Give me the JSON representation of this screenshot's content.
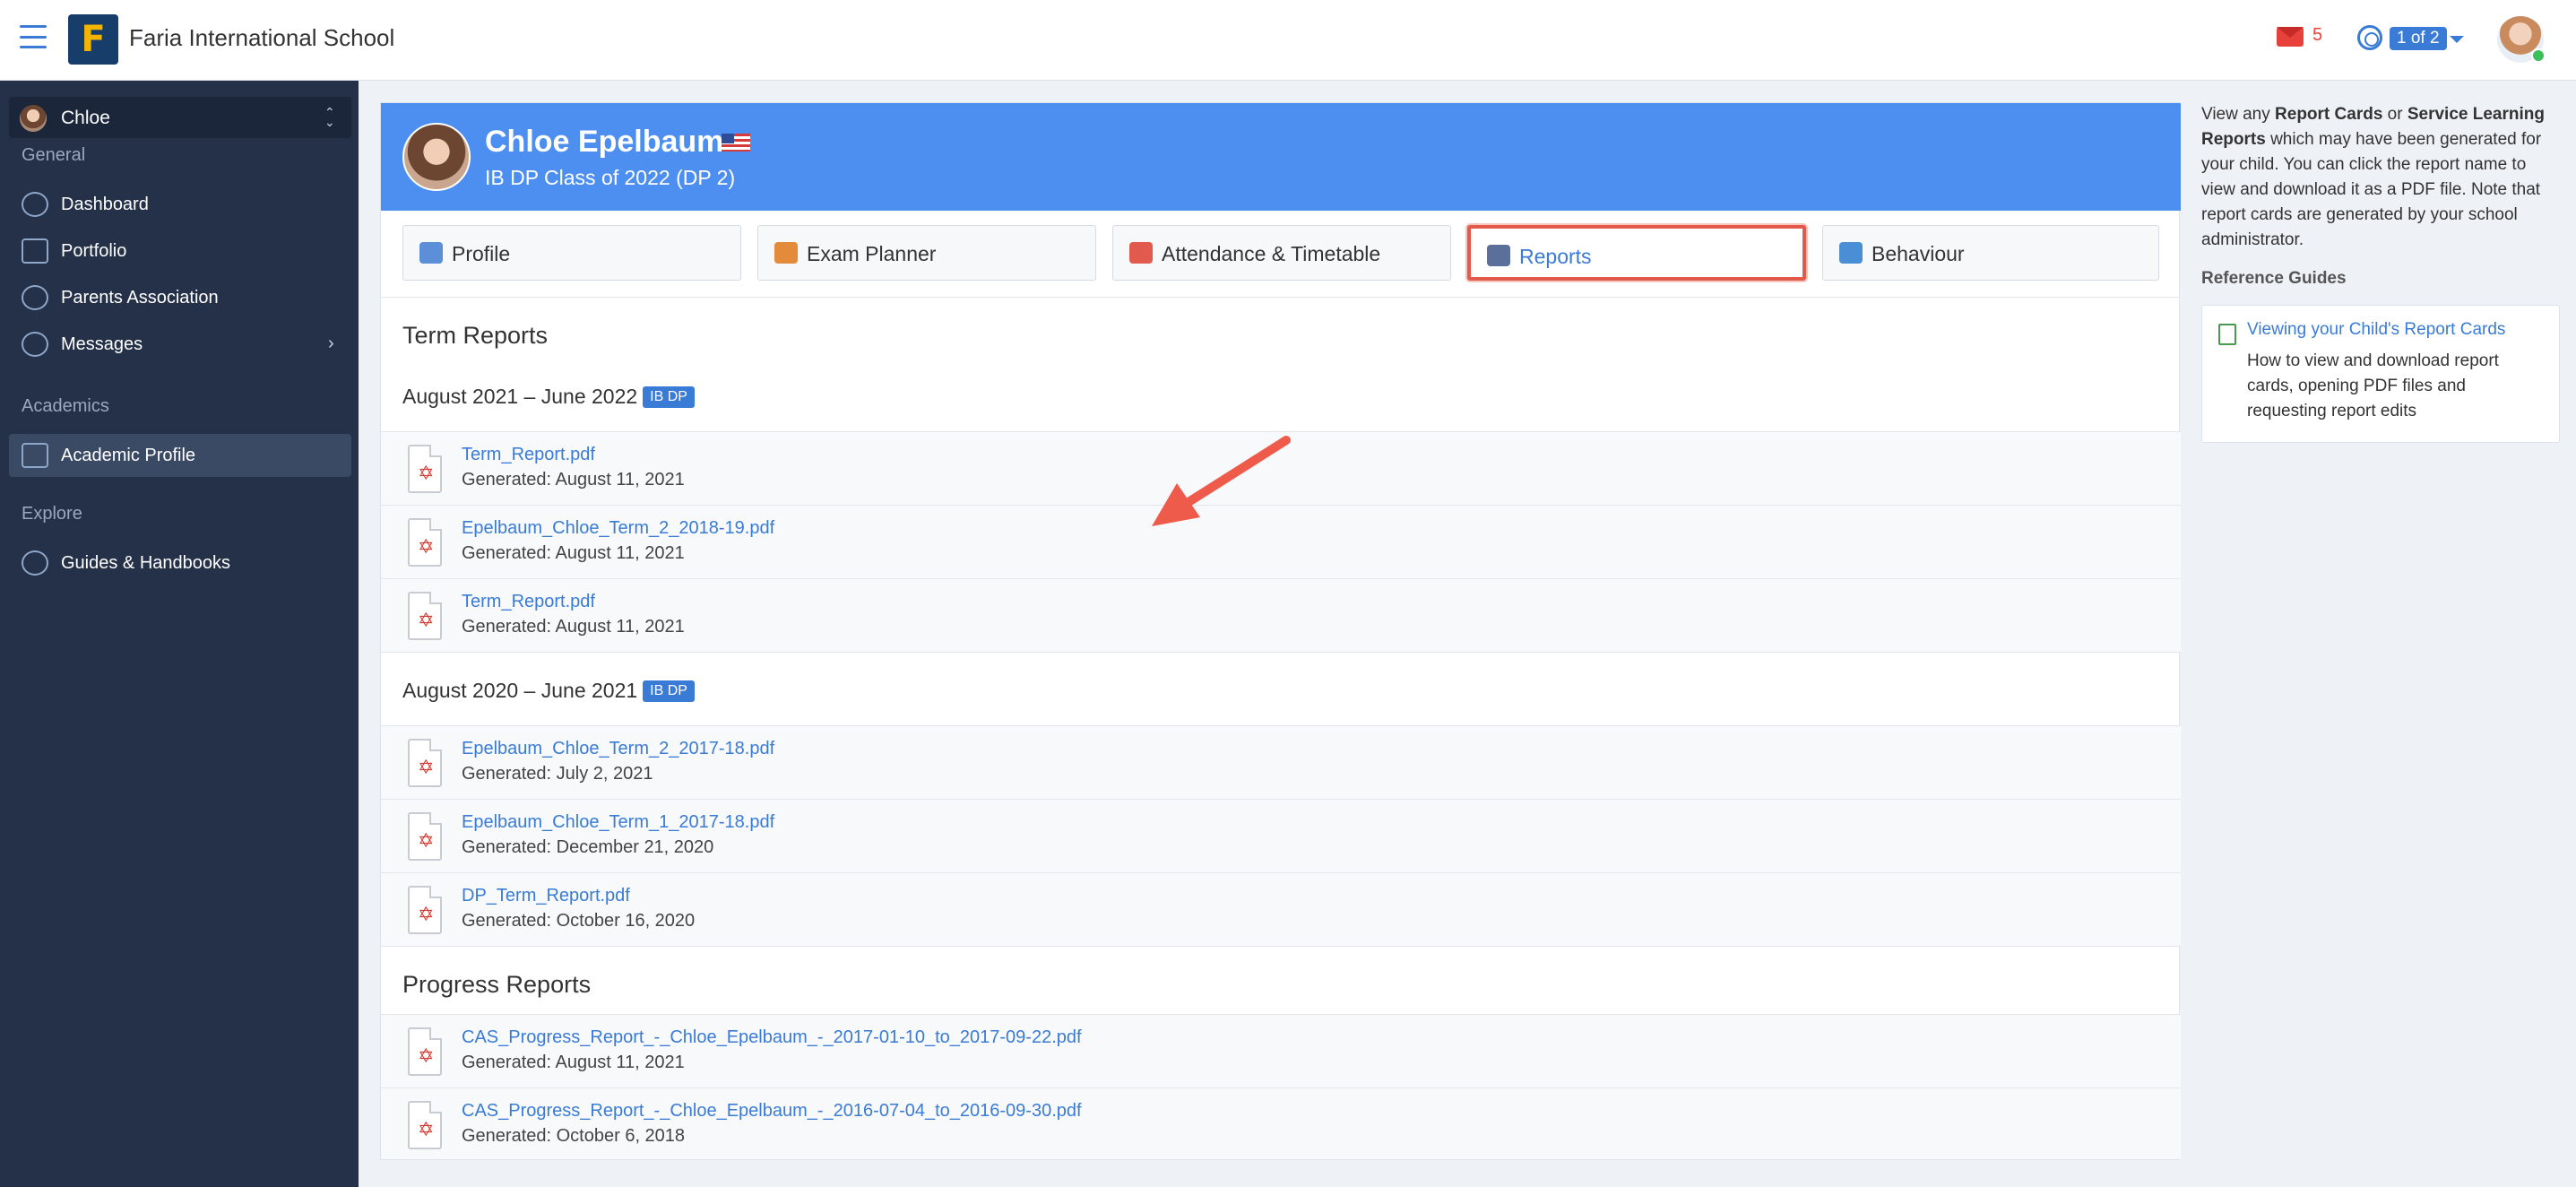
{
  "header": {
    "school_name": "Faria International School",
    "logo_letter": "F",
    "mail_count": "5",
    "family_badge": "1 of 2"
  },
  "sidebar": {
    "child_name": "Chloe",
    "sections": [
      {
        "label": "General"
      },
      {
        "label": "Academics"
      },
      {
        "label": "Explore"
      }
    ],
    "items": [
      {
        "label": "Dashboard"
      },
      {
        "label": "Portfolio"
      },
      {
        "label": "Parents Association"
      },
      {
        "label": "Messages"
      },
      {
        "label": "Academic Profile"
      },
      {
        "label": "Guides & Handbooks"
      }
    ]
  },
  "student": {
    "name": "Chloe Epelbaum",
    "class": "IB DP Class of 2022 (DP 2)"
  },
  "tabs": [
    {
      "label": "Profile"
    },
    {
      "label": "Exam Planner"
    },
    {
      "label": "Attendance & Timetable"
    },
    {
      "label": "Reports"
    },
    {
      "label": "Behaviour"
    }
  ],
  "term_reports": {
    "title": "Term Reports",
    "groups": [
      {
        "period": "August 2021 – June 2022",
        "badge": "IB DP",
        "files": [
          {
            "name": "Term_Report.pdf",
            "generated": "Generated: August 11, 2021"
          },
          {
            "name": "Epelbaum_Chloe_Term_2_2018-19.pdf",
            "generated": "Generated: August 11, 2021"
          },
          {
            "name": "Term_Report.pdf",
            "generated": "Generated: August 11, 2021"
          }
        ]
      },
      {
        "period": "August 2020 – June 2021",
        "badge": "IB DP",
        "files": [
          {
            "name": "Epelbaum_Chloe_Term_2_2017-18.pdf",
            "generated": "Generated: July 2, 2021"
          },
          {
            "name": "Epelbaum_Chloe_Term_1_2017-18.pdf",
            "generated": "Generated: December 21, 2020"
          },
          {
            "name": "DP_Term_Report.pdf",
            "generated": "Generated: October 16, 2020"
          }
        ]
      }
    ]
  },
  "progress_reports": {
    "title": "Progress Reports",
    "files": [
      {
        "name": "CAS_Progress_Report_-_Chloe_Epelbaum_-_2017-01-10_to_2017-09-22.pdf",
        "generated": "Generated: August 11, 2021"
      },
      {
        "name": "CAS_Progress_Report_-_Chloe_Epelbaum_-_2016-07-04_to_2016-09-30.pdf",
        "generated": "Generated: October 6, 2018"
      }
    ]
  },
  "help": {
    "p1": "View any ",
    "b1": "Report Cards",
    "p2": " or ",
    "b2": "Service Learning Reports",
    "p3": " which may have been generated for your child. You can click the report name to view and download it as a PDF file. Note that report cards are generated by your school administrator.",
    "ref_label": "Reference Guides",
    "ref_link": "Viewing your Child's Report Cards",
    "ref_desc": "How to view and download report cards, opening PDF files and requesting report edits"
  },
  "colors": {
    "accent": "#3a7bd5",
    "banner": "#4d8ff1",
    "sidebar": "#243149",
    "highlight": "#e35a4a"
  }
}
